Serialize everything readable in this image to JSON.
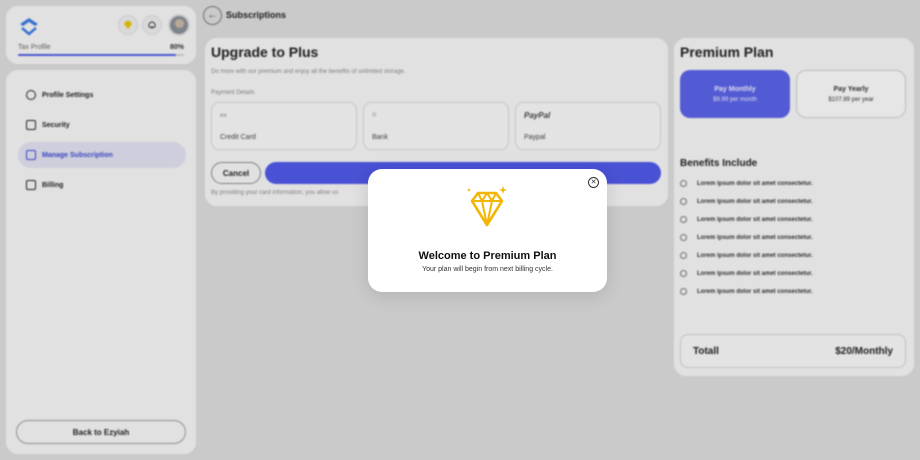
{
  "profile": {
    "tax_label": "Tax Profile",
    "tax_pct": "80%",
    "tax_progress": 0.95
  },
  "sidebar": {
    "items": [
      {
        "label": "Profile Settings",
        "icon": "user-gear-icon",
        "active": false
      },
      {
        "label": "Security",
        "icon": "lock-icon",
        "active": false
      },
      {
        "label": "Manage Subscription",
        "icon": "subscription-icon",
        "active": true
      },
      {
        "label": "Billing",
        "icon": "document-icon",
        "active": false
      }
    ],
    "back_label": "Back to Ezyiah"
  },
  "header": {
    "title": "Subscriptions"
  },
  "main": {
    "heading": "Upgrade to Plus",
    "subtitle": "Do more with our premium and enjoy all the benefits of unlimited storage.",
    "payment_label": "Payment Details",
    "payment_options": [
      {
        "label": "Credit Card",
        "icon": "card-icon"
      },
      {
        "label": "Bank",
        "icon": "bank-icon"
      },
      {
        "label": "Paypal",
        "icon": "paypal-logo",
        "logo_text": "PayPal"
      }
    ],
    "cancel_label": "Cancel",
    "disclaimer": "By providing your card information, you allow us"
  },
  "premium": {
    "heading": "Premium Plan",
    "plans": [
      {
        "title": "Pay Monthly",
        "price": "$9.99 per month",
        "selected": true
      },
      {
        "title": "Pay Yearly",
        "price": "$107.89 per year",
        "selected": false
      }
    ],
    "benefits_heading": "Benefits Include",
    "benefits": [
      "Lorem ipsum dolor sit amet consectetur.",
      "Lorem ipsum dolor sit amet consectetur.",
      "Lorem ipsum dolor sit amet consectetur.",
      "Lorem ipsum dolor sit amet consectetur.",
      "Lorem ipsum dolor sit amet consectetur.",
      "Lorem ipsum dolor sit amet consectetur.",
      "Lorem ipsum dolor sit amet consectetur."
    ],
    "total_label": "Totall",
    "total_value": "$20/Monthly"
  },
  "modal": {
    "title": "Welcome to Premium Plan",
    "subtitle": "Your plan will begin from next billing cycle.",
    "icon": "diamond-icon",
    "close_icon": "close-icon"
  },
  "colors": {
    "accent": "#5058e8",
    "gold": "#f2b705"
  }
}
